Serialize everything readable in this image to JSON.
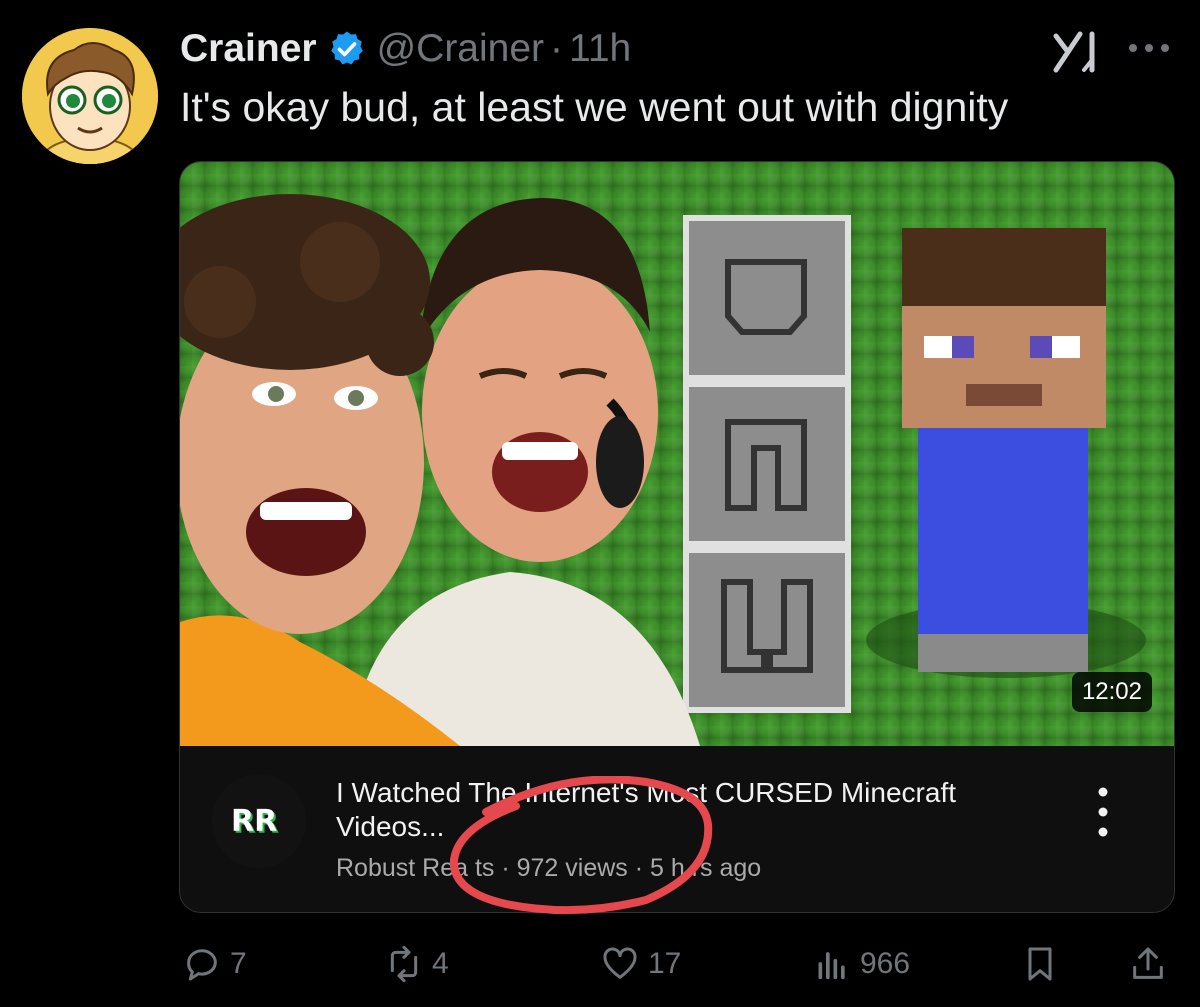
{
  "tweet": {
    "display_name": "Crainer",
    "handle": "@Crainer",
    "separator": "·",
    "time": "11h",
    "text": "It's okay bud, at least we went out with dignity"
  },
  "video_card": {
    "duration": "12:02",
    "title": "I Watched The Internet's Most CURSED Minecraft Videos...",
    "channel": "Robust Reacts",
    "views": "972 views",
    "age": "5 hours ago",
    "channel_logo_text": "RR",
    "subtitle_text": "Robust Rea  ts · 972 views · 5 h  rs ago"
  },
  "actions": {
    "replies": "7",
    "reposts": "4",
    "likes": "17",
    "views": "966"
  },
  "colors": {
    "background": "#000000",
    "verified_blue": "#1d9bf0",
    "muted_text": "#71767b",
    "annotation_red": "#e5484d",
    "grass_green": "#3d8c2a"
  },
  "icons": [
    "verified-badge-icon",
    "grok-icon",
    "more-horizontal-icon",
    "kebab-menu-icon",
    "reply-icon",
    "repost-icon",
    "like-icon",
    "views-icon",
    "bookmark-icon",
    "share-icon"
  ]
}
